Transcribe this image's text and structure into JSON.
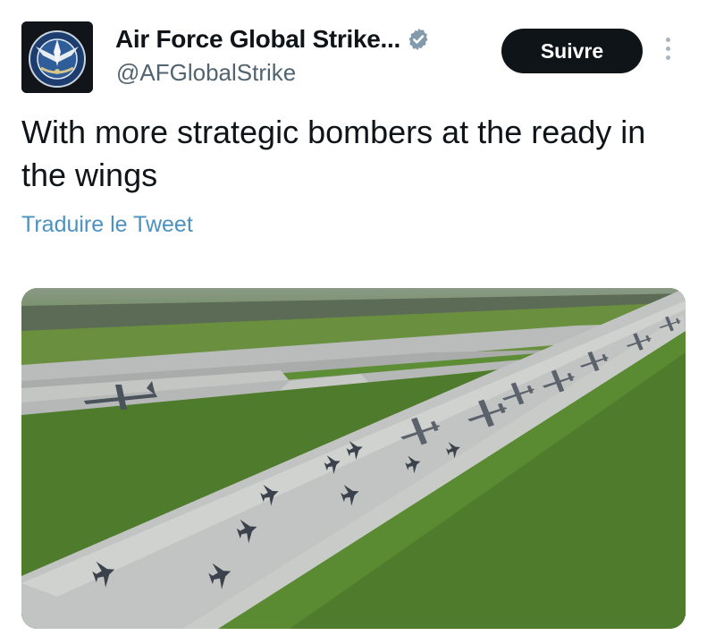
{
  "tweet": {
    "author": {
      "display_name": "Air Force Global Strike...",
      "handle": "@AFGlobalStrike",
      "verified": true,
      "avatar_icon": "afgsc-emblem-icon"
    },
    "follow_label": "Suivre",
    "more_icon": "vertical-ellipsis-icon",
    "text": "With more strategic bombers at the ready in the wings",
    "translate_label": "Traduire le Tweet",
    "media": {
      "kind": "photo",
      "subject": "aircraft lined up on runway"
    }
  },
  "colors": {
    "follow_bg": "#0f1419",
    "follow_text": "#ffffff",
    "link": "#1d9bf0",
    "handle": "#536471",
    "verified_badge": "#829aab"
  }
}
